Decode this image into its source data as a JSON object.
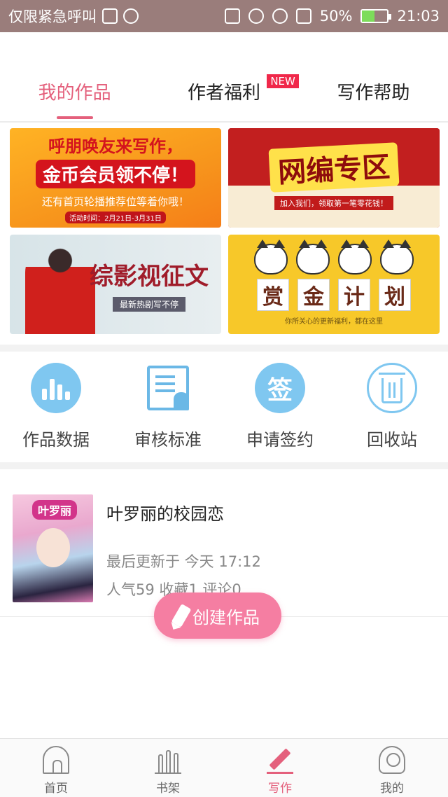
{
  "status_bar": {
    "notice": "仅限紧急呼叫",
    "battery": "50%",
    "battery_level": 0.5,
    "time": "21:03"
  },
  "tabs": [
    {
      "label": "我的作品",
      "active": true
    },
    {
      "label": "作者福利",
      "badge": "NEW"
    },
    {
      "label": "写作帮助"
    }
  ],
  "banners": {
    "b1": {
      "line1": "呼朋唤友来写作，",
      "line2": "金币会员领不停！",
      "line3": "还有首页轮播推荐位等着你哦！",
      "line4": "活动时间：2月21日-3月31日"
    },
    "b2": {
      "line1": "网编专区",
      "line2": "加入我们，领取第一笔零花钱！"
    },
    "b3": {
      "line1": "综影视征文",
      "line2": "最新热剧写不停"
    },
    "b4": {
      "chars": [
        "赏",
        "金",
        "计",
        "划"
      ],
      "line2": "你所关心的更新福利，都在这里"
    }
  },
  "actions": [
    {
      "label": "作品数据",
      "icon": "bar-chart-icon"
    },
    {
      "label": "审核标准",
      "icon": "review-document-icon"
    },
    {
      "label": "申请签约",
      "icon": "sign-contract-icon",
      "glyph": "签"
    },
    {
      "label": "回收站",
      "icon": "trash-icon"
    }
  ],
  "works": [
    {
      "title": "叶罗丽的校园恋",
      "cover_title": "叶罗丽",
      "updated_label": "最后更新于 今天 17:12",
      "stats": "人气59  收藏1  评论0"
    }
  ],
  "fab": {
    "label": "创建作品"
  },
  "bottom_nav": [
    {
      "label": "首页",
      "icon": "home-icon"
    },
    {
      "label": "书架",
      "icon": "bookshelf-icon"
    },
    {
      "label": "写作",
      "icon": "pencil-icon",
      "active": true
    },
    {
      "label": "我的",
      "icon": "profile-icon"
    }
  ],
  "colors": {
    "accent": "#e4607c",
    "fab": "#f57ea2",
    "icon_blue": "#7fc7f0",
    "status_bar": "#9a7d7b",
    "new_badge": "#f0284a"
  }
}
